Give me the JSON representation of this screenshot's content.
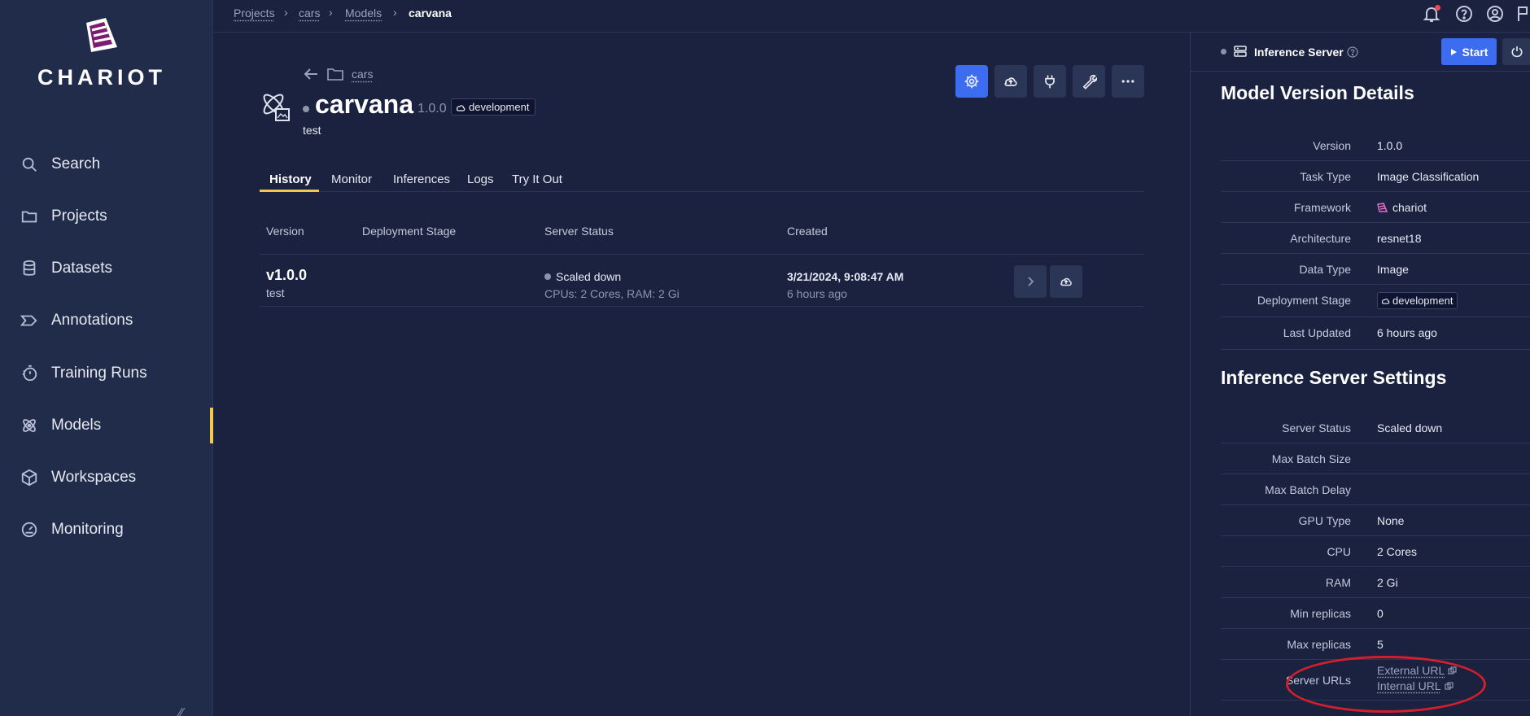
{
  "app": {
    "name": "CHARIOT"
  },
  "colors": {
    "accent": "#3c6df0",
    "active_indicator": "#f2c94c",
    "annotation": "#d21f2b"
  },
  "sidebar": {
    "items": [
      {
        "label": "Search",
        "icon": "search-icon"
      },
      {
        "label": "Projects",
        "icon": "folder-icon"
      },
      {
        "label": "Datasets",
        "icon": "database-icon"
      },
      {
        "label": "Annotations",
        "icon": "tag-icon"
      },
      {
        "label": "Training Runs",
        "icon": "stopwatch-icon"
      },
      {
        "label": "Models",
        "icon": "atom-icon",
        "active": true
      },
      {
        "label": "Workspaces",
        "icon": "cube-icon"
      },
      {
        "label": "Monitoring",
        "icon": "gauge-icon"
      }
    ]
  },
  "breadcrumb": [
    "Projects",
    "cars",
    "Models",
    "carvana"
  ],
  "model": {
    "back_folder": "cars",
    "name": "carvana",
    "version": "1.0.0",
    "stage": "development",
    "description": "test"
  },
  "tabs": [
    "History",
    "Monitor",
    "Inferences",
    "Logs",
    "Try It Out"
  ],
  "history_table": {
    "columns": [
      "Version",
      "Deployment Stage",
      "Server Status",
      "Created"
    ],
    "rows": [
      {
        "version": "v1.0.0",
        "description": "test",
        "server_status": "Scaled down",
        "resources": "CPUs: 2 Cores,  RAM: 2 Gi",
        "created": "3/21/2024, 9:08:47 AM",
        "created_relative": "6 hours ago"
      }
    ]
  },
  "panel": {
    "header_title": "Inference Server",
    "start_label": "Start",
    "details_title": "Model Version Details",
    "details": [
      {
        "key": "Version",
        "value": "1.0.0"
      },
      {
        "key": "Task Type",
        "value": "Image Classification"
      },
      {
        "key": "Framework",
        "value": "chariot"
      },
      {
        "key": "Architecture",
        "value": "resnet18"
      },
      {
        "key": "Data Type",
        "value": "Image"
      },
      {
        "key": "Deployment Stage",
        "value": "development"
      },
      {
        "key": "Last Updated",
        "value": "6 hours ago"
      }
    ],
    "settings_title": "Inference Server Settings",
    "settings": [
      {
        "key": "Server Status",
        "value": "Scaled down"
      },
      {
        "key": "Max Batch Size",
        "value": ""
      },
      {
        "key": "Max Batch Delay",
        "value": ""
      },
      {
        "key": "GPU Type",
        "value": "None"
      },
      {
        "key": "CPU",
        "value": "2 Cores"
      },
      {
        "key": "RAM",
        "value": "2 Gi"
      },
      {
        "key": "Min replicas",
        "value": "0"
      },
      {
        "key": "Max replicas",
        "value": "5"
      }
    ],
    "server_urls_label": "Server URLs",
    "external_url_label": "External URL",
    "internal_url_label": "Internal URL"
  }
}
